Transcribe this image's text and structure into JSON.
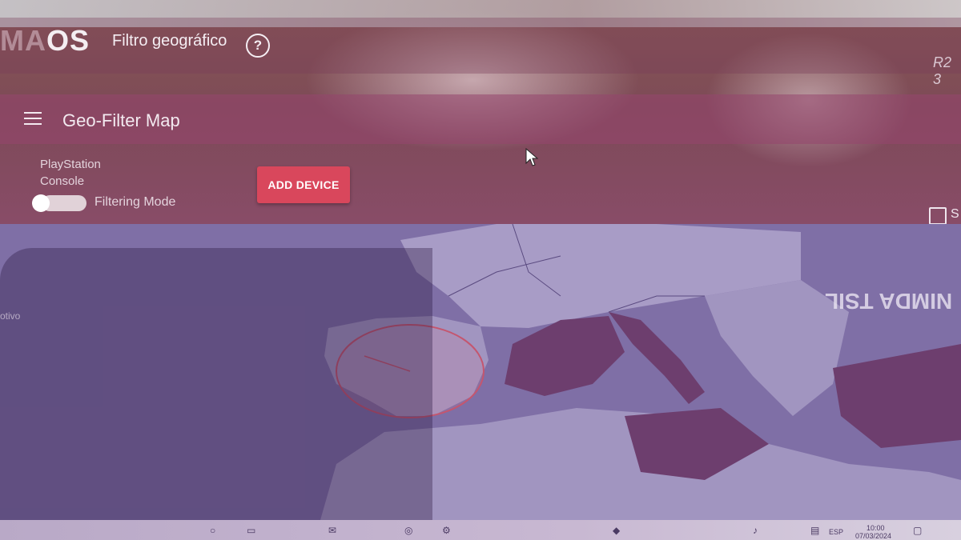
{
  "header": {
    "logo_main": "MA",
    "logo_suffix": "OS",
    "title": "Filtro geográfico",
    "help_icon": "question-circle-icon",
    "right_tag": "R2 3"
  },
  "subbar": {
    "menu_icon": "hamburger-menu-icon",
    "title": "Geo-Filter Map"
  },
  "controls": {
    "device_label": "PlayStation Console",
    "filtering_mode_label": "Filtering Mode",
    "add_device_label": "ADD DEVICE",
    "checkbox_label": "S"
  },
  "map": {
    "mirror_text": "NIMDA TSIL",
    "left_label": "otivo"
  },
  "taskbar": {
    "language": "ESP",
    "time": "10:00",
    "date": "07/03/2024"
  },
  "colors": {
    "accent_button": "#d9475c",
    "header_bg": "#7d4a57",
    "map_land": "#8f7fb0",
    "map_sea": "#7a6aa0"
  }
}
